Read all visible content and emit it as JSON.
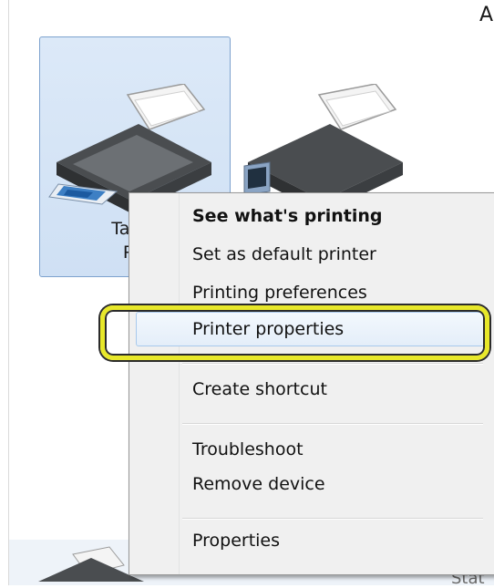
{
  "header": {
    "partial_text": "A"
  },
  "devices": [
    {
      "label_line1": "Taggi",
      "label_line2": "Pri",
      "selected": true
    },
    {
      "selected": false
    }
  ],
  "context_menu": {
    "items": [
      {
        "label": "See what's printing",
        "bold": true
      },
      {
        "label": "Set as default printer"
      },
      {
        "label": "Printing preferences"
      },
      {
        "label": "Printer properties",
        "highlighted": true
      },
      {
        "label": "Create shortcut"
      },
      {
        "label": "Troubleshoot"
      },
      {
        "label": "Remove device"
      },
      {
        "label": "Properties"
      }
    ]
  },
  "footer": {
    "status_partial": "Stat"
  },
  "colors": {
    "highlight_ring": "#e8e82a",
    "selection": "#cfe0f4",
    "menu_bg": "#f0f0f0"
  },
  "icons": [
    "printer-icon"
  ]
}
